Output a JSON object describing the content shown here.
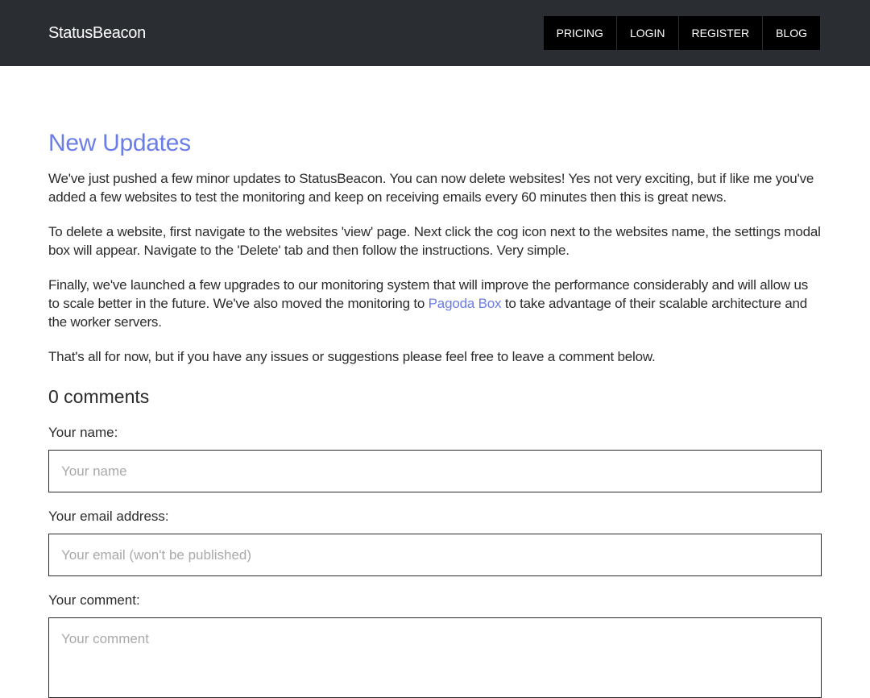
{
  "header": {
    "brand": "StatusBeacon",
    "nav": [
      {
        "label": "PRICING"
      },
      {
        "label": "LOGIN"
      },
      {
        "label": "REGISTER"
      },
      {
        "label": "BLOG"
      }
    ]
  },
  "post": {
    "title": "New Updates",
    "paragraph_1": "We've just pushed a few minor updates to StatusBeacon. You can now delete websites! Yes not very exciting, but if like me you've added a few websites to test the monitoring and keep on receiving emails every 60 minutes then this is great news.",
    "paragraph_2": "To delete a website, first navigate to the websites 'view' page. Next click the cog icon next to the websites name, the settings modal box will appear. Navigate to the 'Delete' tab and then follow the instructions. Very simple.",
    "paragraph_3_before_link": "Finally, we've launched a few upgrades to our monitoring system that will improve the performance considerably and will allow us to scale better in the future. We've also moved the monitoring to ",
    "paragraph_3_link": "Pagoda Box",
    "paragraph_3_after_link": " to take advantage of their scalable architecture and the worker servers.",
    "paragraph_4": "That's all for now, but if you have any issues or suggestions please feel free to leave a comment below."
  },
  "comments": {
    "heading": "0 comments",
    "name_label": "Your name:",
    "name_placeholder": "Your name",
    "email_label": "Your email address:",
    "email_placeholder": "Your email (won't be published)",
    "comment_label": "Your comment:",
    "comment_placeholder": "Your comment"
  },
  "colors": {
    "header_bg": "#2a2d31",
    "nav_bg": "#000000",
    "accent": "#6b7de6"
  }
}
